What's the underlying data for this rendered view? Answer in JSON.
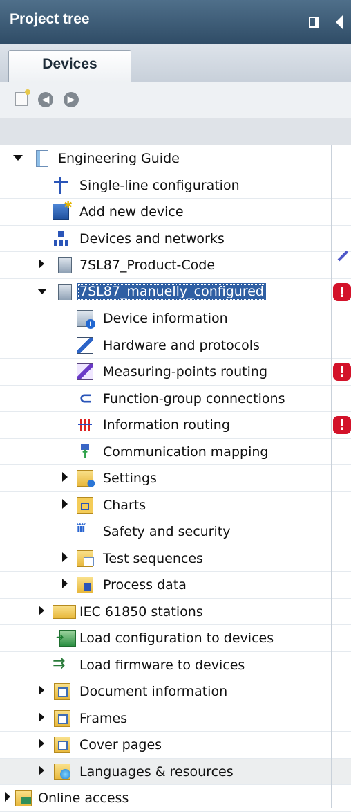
{
  "header": {
    "title": "Project tree"
  },
  "tabs": [
    {
      "label": "Devices",
      "active": true
    }
  ],
  "toolbar": {
    "icons": [
      "new-item-icon",
      "back-icon",
      "forward-icon"
    ]
  },
  "tree": {
    "items": [
      {
        "label": "Engineering Guide",
        "expanded": true,
        "icon": "project-icon"
      },
      {
        "label": "Single-line configuration",
        "icon": "single-line-icon"
      },
      {
        "label": "Add new device",
        "icon": "add-device-icon"
      },
      {
        "label": "Devices and networks",
        "icon": "network-icon"
      },
      {
        "label": "7SL87_Product-Code",
        "expanded": false,
        "icon": "device-icon"
      },
      {
        "label": "7SL87_manuelly_configured",
        "expanded": true,
        "selected": true,
        "icon": "device-icon",
        "status": "error"
      },
      {
        "label": "Device information",
        "icon": "device-info-icon"
      },
      {
        "label": "Hardware and protocols",
        "icon": "hardware-icon"
      },
      {
        "label": "Measuring-points routing",
        "icon": "measuring-icon",
        "status": "error"
      },
      {
        "label": "Function-group connections",
        "icon": "function-group-icon"
      },
      {
        "label": "Information routing",
        "icon": "info-routing-icon",
        "status": "error"
      },
      {
        "label": "Communication mapping",
        "icon": "comm-mapping-icon"
      },
      {
        "label": "Settings",
        "expanded": false,
        "icon": "settings-folder-icon"
      },
      {
        "label": "Charts",
        "expanded": false,
        "icon": "charts-folder-icon"
      },
      {
        "label": "Safety and security",
        "icon": "safety-icon"
      },
      {
        "label": "Test sequences",
        "expanded": false,
        "icon": "test-folder-icon"
      },
      {
        "label": "Process data",
        "expanded": false,
        "icon": "process-data-icon"
      },
      {
        "label": "IEC 61850 stations",
        "expanded": false,
        "icon": "folder-icon"
      },
      {
        "label": "Load configuration to devices",
        "icon": "load-config-icon"
      },
      {
        "label": "Load firmware to devices",
        "icon": "load-firmware-icon"
      },
      {
        "label": "Document information",
        "expanded": false,
        "icon": "doc-info-folder-icon"
      },
      {
        "label": "Frames",
        "expanded": false,
        "icon": "frames-folder-icon"
      },
      {
        "label": "Cover pages",
        "expanded": false,
        "icon": "cover-pages-folder-icon"
      },
      {
        "label": "Languages & resources",
        "expanded": false,
        "icon": "languages-folder-icon"
      },
      {
        "label": "Online access",
        "expanded": false,
        "icon": "online-access-icon"
      }
    ]
  },
  "colors": {
    "header": "#2f4c66",
    "selection": "#2f5fa3",
    "error": "#d3122a"
  }
}
